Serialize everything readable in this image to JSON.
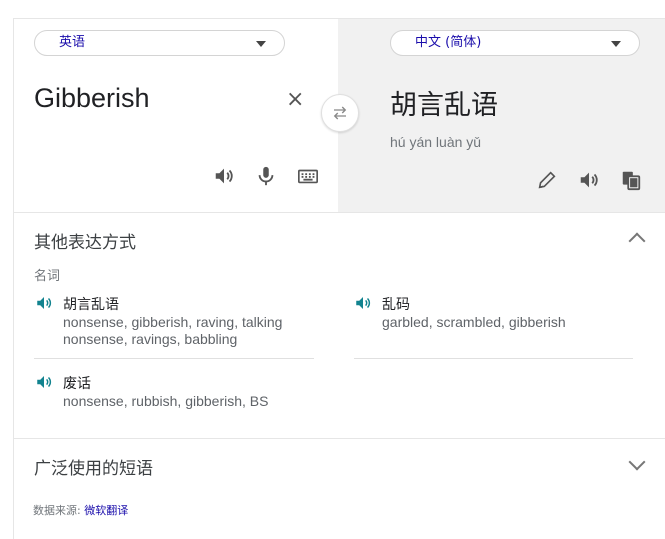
{
  "source": {
    "language": "英语",
    "text": "Gibberish",
    "clear_label": "×"
  },
  "target": {
    "language": "中文 (简体)",
    "text": "胡言乱语",
    "pinyin": "hú yán luàn yǔ"
  },
  "icons": {
    "speaker": "speaker-icon",
    "mic": "microphone-icon",
    "keyboard": "keyboard-icon",
    "swap": "swap-icon",
    "edit": "pencil-icon",
    "copy": "copy-icon"
  },
  "other_expressions": {
    "title": "其他表达方式",
    "part_of_speech": "名词",
    "items": [
      {
        "word": "胡言乱语",
        "synonyms": [
          "nonsense, gibberish, raving, talking",
          "nonsense, ravings, babbling"
        ]
      },
      {
        "word": "乱码",
        "synonyms": [
          "garbled, scrambled, gibberish"
        ]
      },
      {
        "word": "废话",
        "synonyms": [
          "nonsense, rubbish, gibberish, BS"
        ]
      }
    ]
  },
  "common_phrases": {
    "title": "广泛使用的短语"
  },
  "footer": {
    "prefix": "数据来源: ",
    "link": "微软翻译"
  },
  "colors": {
    "accent": "#1a0dab",
    "speaker_teal": "#12838f",
    "target_bg": "#f1f1f1"
  }
}
